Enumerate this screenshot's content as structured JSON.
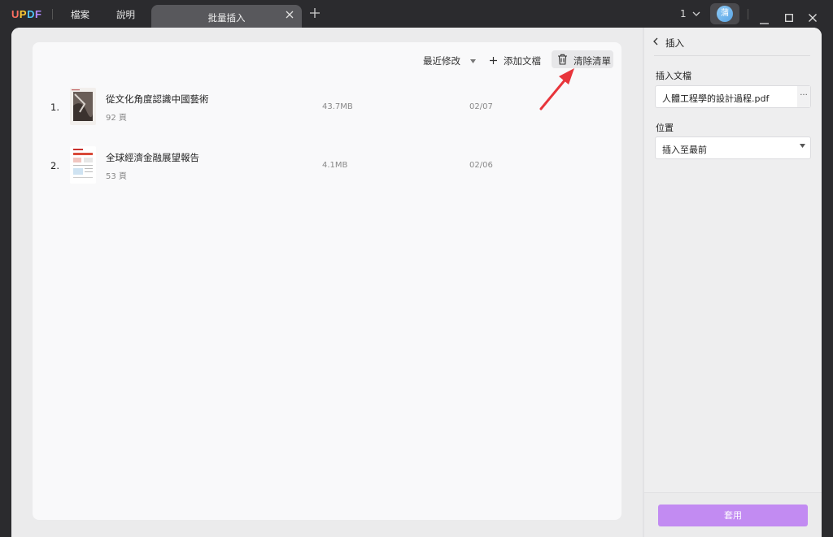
{
  "titlebar": {
    "logo": [
      "U",
      "P",
      "D",
      "F"
    ],
    "logo_colors": [
      "#ff6f61",
      "#ffcc33",
      "#4fc3f7",
      "#b388ff"
    ],
    "menu": [
      "檔案",
      "說明"
    ],
    "tab_title": "批量插入",
    "page_indicator": "1",
    "avatar_initial": "蒲"
  },
  "toolbar": {
    "sort_label": "最近修改",
    "add_label": "添加文檔",
    "clear_label": "清除清單"
  },
  "files": [
    {
      "index": "1.",
      "name": "從文化角度認識中國藝術",
      "pages": "92 頁",
      "size": "43.7MB",
      "date": "02/07"
    },
    {
      "index": "2.",
      "name": "全球經濟金融展望報告",
      "pages": "53 頁",
      "size": "4.1MB",
      "date": "02/06"
    }
  ],
  "panel": {
    "title": "插入",
    "doc_label": "插入文檔",
    "doc_value": "人體工程學的設計過程.pdf",
    "more_label": "···",
    "position_label": "位置",
    "position_value": "插入至最前",
    "apply_label": "套用"
  },
  "colors": {
    "accent": "#c28bf2",
    "arrow": "#e8353b"
  }
}
